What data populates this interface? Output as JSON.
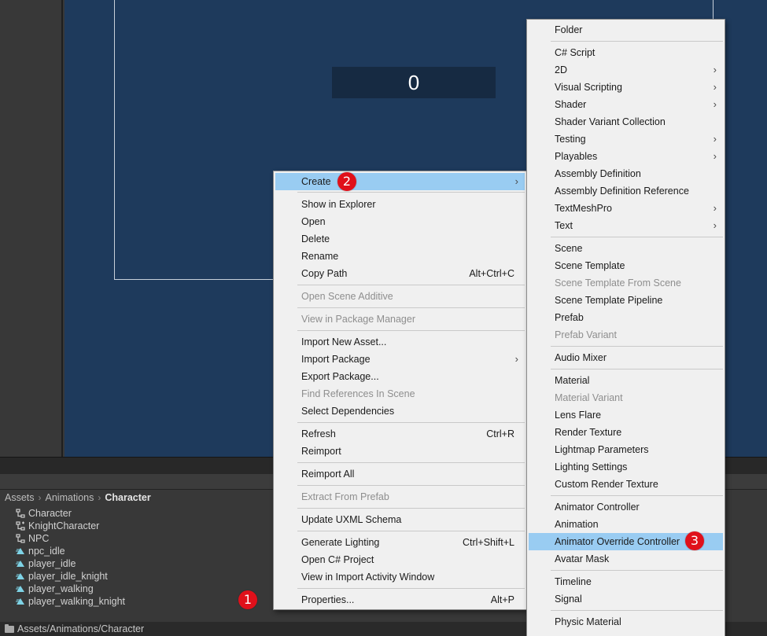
{
  "game_view": {
    "score": "0"
  },
  "breadcrumb": {
    "items": [
      "Assets",
      "Animations"
    ],
    "current": "Character"
  },
  "project_items": [
    {
      "name": "Character",
      "icon": "animator-controller-icon"
    },
    {
      "name": "KnightCharacter",
      "icon": "animator-override-icon"
    },
    {
      "name": "NPC",
      "icon": "animator-controller-icon"
    },
    {
      "name": "npc_idle",
      "icon": "animation-clip-icon"
    },
    {
      "name": "player_idle",
      "icon": "animation-clip-icon"
    },
    {
      "name": "player_idle_knight",
      "icon": "animation-clip-icon"
    },
    {
      "name": "player_walking",
      "icon": "animation-clip-icon"
    },
    {
      "name": "player_walking_knight",
      "icon": "animation-clip-icon"
    }
  ],
  "status_path": "Assets/Animations/Character",
  "context_menu": {
    "create": "Create",
    "show_in_explorer": "Show in Explorer",
    "open": "Open",
    "delete": "Delete",
    "rename": "Rename",
    "copy_path": "Copy Path",
    "copy_path_shortcut": "Alt+Ctrl+C",
    "open_scene_additive": "Open Scene Additive",
    "view_in_package_manager": "View in Package Manager",
    "import_new_asset": "Import New Asset...",
    "import_package": "Import Package",
    "export_package": "Export Package...",
    "find_references": "Find References In Scene",
    "select_dependencies": "Select Dependencies",
    "refresh": "Refresh",
    "refresh_shortcut": "Ctrl+R",
    "reimport": "Reimport",
    "reimport_all": "Reimport All",
    "extract_from_prefab": "Extract From Prefab",
    "update_uxml_schema": "Update UXML Schema",
    "generate_lighting": "Generate Lighting",
    "generate_lighting_shortcut": "Ctrl+Shift+L",
    "open_csharp_project": "Open C# Project",
    "view_in_import_activity": "View in Import Activity Window",
    "properties": "Properties...",
    "properties_shortcut": "Alt+P"
  },
  "create_submenu": {
    "folder": "Folder",
    "csharp_script": "C# Script",
    "two_d": "2D",
    "visual_scripting": "Visual Scripting",
    "shader": "Shader",
    "shader_variant_collection": "Shader Variant Collection",
    "testing": "Testing",
    "playables": "Playables",
    "assembly_definition": "Assembly Definition",
    "assembly_definition_reference": "Assembly Definition Reference",
    "textmeshpro": "TextMeshPro",
    "text": "Text",
    "scene": "Scene",
    "scene_template": "Scene Template",
    "scene_template_from_scene": "Scene Template From Scene",
    "scene_template_pipeline": "Scene Template Pipeline",
    "prefab": "Prefab",
    "prefab_variant": "Prefab Variant",
    "audio_mixer": "Audio Mixer",
    "material": "Material",
    "material_variant": "Material Variant",
    "lens_flare": "Lens Flare",
    "render_texture": "Render Texture",
    "lightmap_parameters": "Lightmap Parameters",
    "lighting_settings": "Lighting Settings",
    "custom_render_texture": "Custom Render Texture",
    "animator_controller": "Animator Controller",
    "animation": "Animation",
    "animator_override_controller": "Animator Override Controller",
    "avatar_mask": "Avatar Mask",
    "timeline": "Timeline",
    "signal": "Signal",
    "physic_material": "Physic Material"
  },
  "badges": {
    "one": "1",
    "two": "2",
    "three": "3"
  },
  "colors": {
    "highlight": "#99ccf2",
    "badge": "#e0101a",
    "game_view_bg": "#1e3a5c"
  },
  "glyphs": {
    "submenu_arrow": "›",
    "breadcrumb_sep": "›"
  }
}
